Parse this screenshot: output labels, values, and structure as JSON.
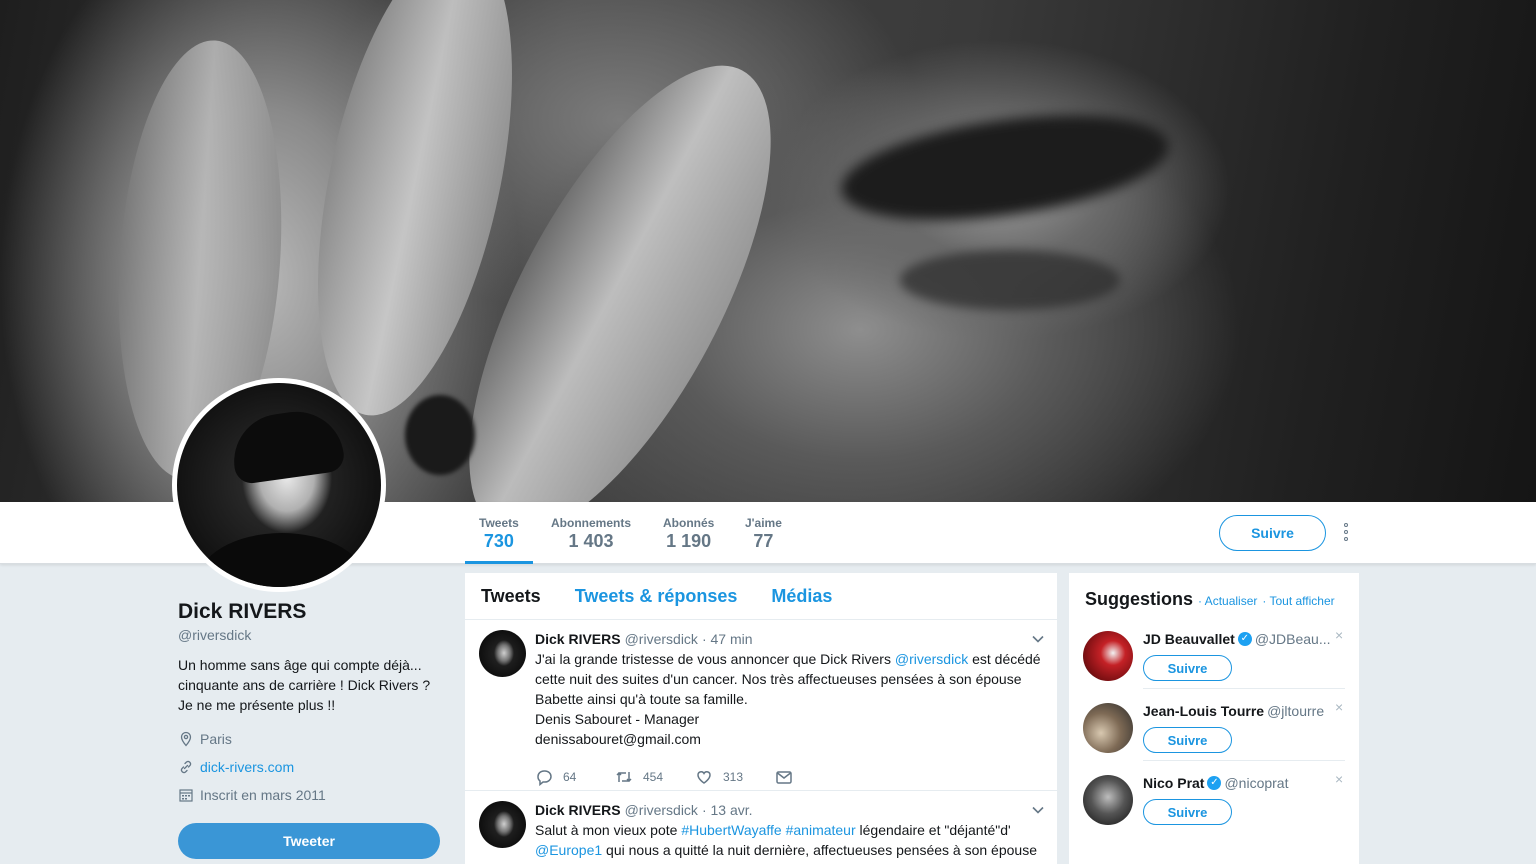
{
  "profile": {
    "name": "Dick RIVERS",
    "handle": "@riversdick",
    "bio": "Un homme sans âge qui compte déjà... cinquante ans de carrière ! Dick Rivers ? Je ne me présente plus !!",
    "location": "Paris",
    "website": "dick-rivers.com",
    "joined": "Inscrit en mars 2011",
    "tweet_button": "Tweeter"
  },
  "stats": [
    {
      "label": "Tweets",
      "value": "730"
    },
    {
      "label": "Abonnements",
      "value": "1 403"
    },
    {
      "label": "Abonnés",
      "value": "1 190"
    },
    {
      "label": "J'aime",
      "value": "77"
    }
  ],
  "follow_label": "Suivre",
  "timeline": {
    "tabs": [
      "Tweets",
      "Tweets & réponses",
      "Médias"
    ],
    "tweets": [
      {
        "name": "Dick RIVERS",
        "handle": "@riversdick",
        "time": "· 47 min",
        "text_1": "J'ai la grande tristesse de vous annoncer que Dick Rivers ",
        "mention": "@riversdick",
        "text_2": " est décédé cette nuit des suites d'un cancer. Nos très affectueuses pensées à son épouse Babette ainsi qu'à toute sa famille.",
        "line_sig": "Denis Sabouret - Manager",
        "line_mail": "denissabouret@gmail.com",
        "replies": "64",
        "retweets": "454",
        "likes": "313"
      },
      {
        "name": "Dick RIVERS",
        "handle": "@riversdick",
        "time": "· 13 avr.",
        "text_1": "Salut à mon vieux pote ",
        "tag_1": "#HubertWayaffe",
        "tag_2": "#animateur",
        "text_2": " légendaire et \"déjanté\"d'",
        "mention": "@Europe1",
        "text_3": " qui nous a quitté la nuit dernière, affectueuses pensées à son épouse"
      }
    ]
  },
  "suggestions": {
    "title": "Suggestions",
    "refresh": "· Actualiser",
    "show_all": "· Tout afficher",
    "items": [
      {
        "name": "JD Beauvallet",
        "handle": "@JDBeau...",
        "verified": true,
        "follow": "Suivre"
      },
      {
        "name": "Jean-Louis Tourre",
        "handle": "@jltourre",
        "verified": false,
        "follow": "Suivre"
      },
      {
        "name": "Nico Prat",
        "handle": "@nicoprat",
        "verified": true,
        "follow": "Suivre"
      }
    ]
  },
  "colors": {
    "accent": "#1b95e0",
    "tweet_button": "#3a96d6",
    "page_bg": "#e6ecf0"
  }
}
